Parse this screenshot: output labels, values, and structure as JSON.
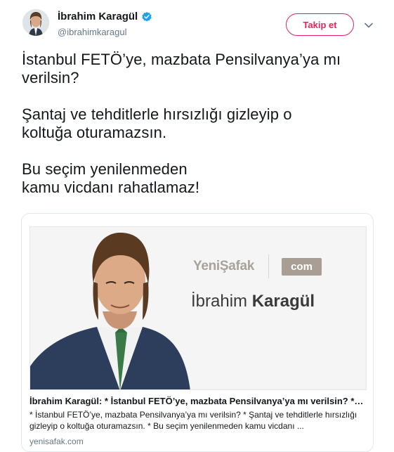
{
  "user": {
    "name": "İbrahim Karagül",
    "handle": "@ibrahimkaragul",
    "verified": true
  },
  "actions": {
    "follow_label": "Takip et"
  },
  "tweet": {
    "lines": [
      "İstanbul FETÖ’ye, mazbata Pensilvanya’ya mı",
      "verilsin?",
      "",
      "Şantaj ve tehditlerle hırsızlığı gizleyip o",
      "koltuğa oturamazsın.",
      "",
      "Bu seçim yenilenmeden",
      "kamu vicdanı rahatlamaz!"
    ]
  },
  "card": {
    "brand": "YeniŞafak",
    "brand_suffix": "com",
    "author_first": "İbrahim",
    "author_last": "Karagül",
    "title": "İbrahim Karagül: * İstanbul FETÖ’ye, mazbata Pensilvanya’ya mı verilsin? * Şantaj ve tehditlerle…",
    "description": "* İstanbul FETÖ’ye, mazbata Pensilvanya’ya mı verilsin? * Şantaj ve tehditlerle hırsızlığı gizleyip o koltuğa oturamazsın. * Bu seçim yenilenmeden kamu vicdanı ...",
    "domain": "yenisafak.com"
  },
  "colors": {
    "follow_accent": "#e0245e",
    "verified_blue": "#1da1f2",
    "secondary_text": "#657786"
  },
  "icons": {
    "verified": "verified-badge-icon",
    "menu": "chevron-down-icon"
  }
}
